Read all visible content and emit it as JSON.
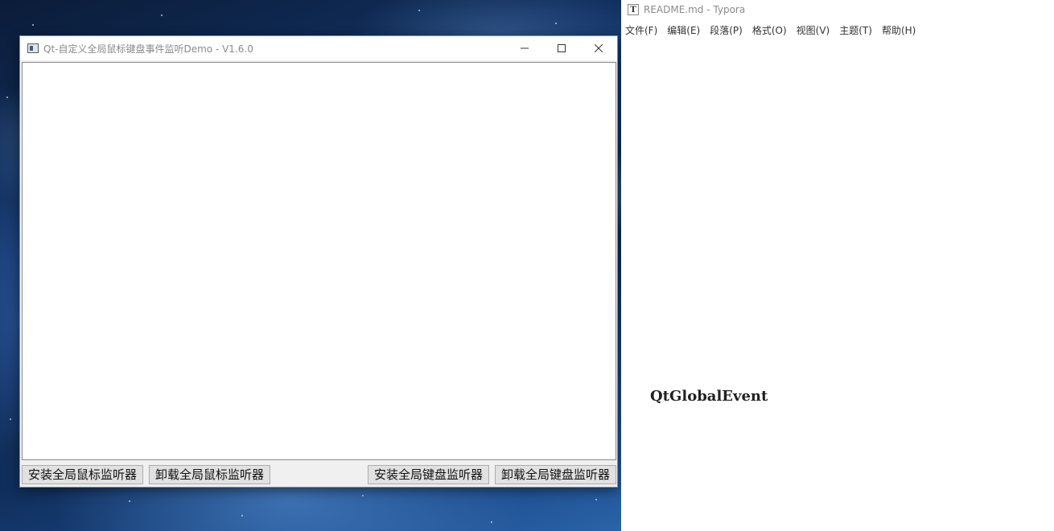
{
  "qt_window": {
    "title": "Qt-自定义全局鼠标键盘事件监听Demo - V1.6.0",
    "controls": {
      "minimize": "—",
      "maximize": "☐",
      "close": "✕"
    },
    "buttons": {
      "install_mouse": "安装全局鼠标监听器",
      "uninstall_mouse": "卸载全局鼠标监听器",
      "install_keyboard": "安装全局键盘监听器",
      "uninstall_keyboard": "卸载全局键盘监听器"
    }
  },
  "typora": {
    "icon": "T",
    "title": "README.md - Typora",
    "menu": [
      "文件(F)",
      "编辑(E)",
      "段落(P)",
      "格式(O)",
      "视图(V)",
      "主题(T)",
      "帮助(H)"
    ],
    "heading": "QtGlobalEvent"
  }
}
